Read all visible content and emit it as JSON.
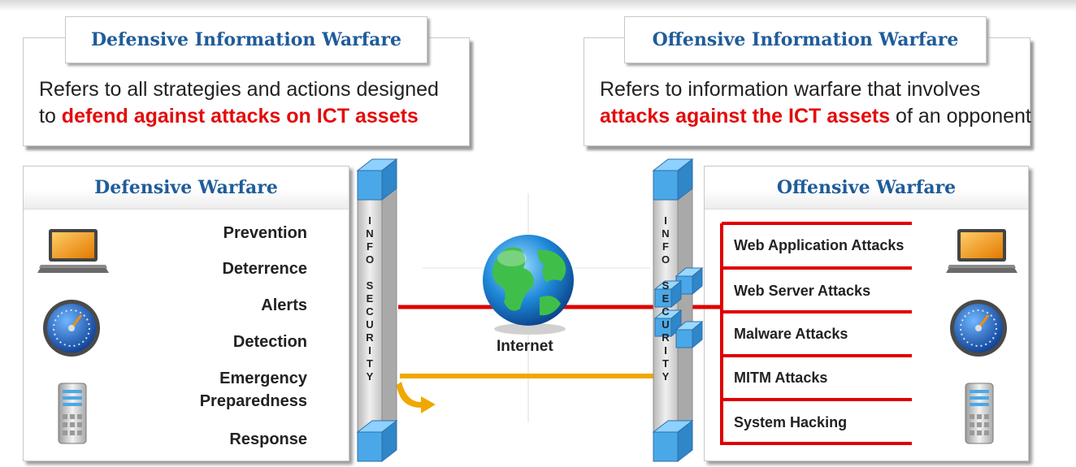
{
  "defensive_box": {
    "title": "Defensive Information Warfare",
    "line1": "Refers to all strategies and actions designed",
    "line2_prefix": "to ",
    "line2_highlight": "defend against attacks on ICT assets"
  },
  "offensive_box": {
    "title": "Offensive Information Warfare",
    "line1": "Refers to information warfare that involves",
    "line2_highlight": "attacks against the ICT assets",
    "line2_suffix": " of an opponent"
  },
  "defensive_panel": {
    "title": "Defensive Warfare",
    "items": [
      "Prevention",
      "Deterrence",
      "Alerts",
      "Detection",
      "Emergency Preparedness",
      "Response"
    ]
  },
  "offensive_panel": {
    "title": "Offensive Warfare",
    "items": [
      "Web Application Attacks",
      "Web Server Attacks",
      "Malware Attacks",
      "MITM Attacks",
      "System Hacking"
    ]
  },
  "pillar_letters": [
    "I",
    "N",
    "F",
    "O",
    "",
    "S",
    "E",
    "C",
    "U",
    "R",
    "I",
    "T",
    "Y"
  ],
  "internet_label": "Internet",
  "icons": {
    "defensive": [
      "laptop-icon",
      "gauge-icon",
      "server-icon"
    ],
    "offensive": [
      "laptop-icon",
      "gauge-icon",
      "server-icon"
    ]
  },
  "colors": {
    "title_blue": "#1f5c99",
    "highlight_red": "#e30c0c",
    "attack_line_red": "#e00000",
    "flow_orange": "#f0a800",
    "cube_blue": "#4aa8e8"
  }
}
